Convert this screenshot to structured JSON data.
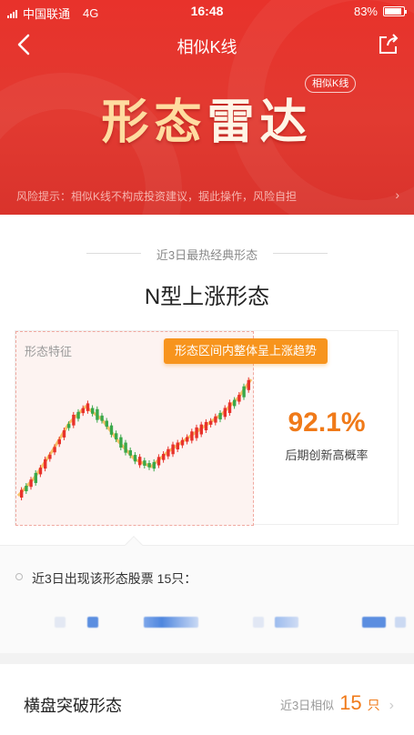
{
  "status_bar": {
    "carrier": "中国联通",
    "network": "4G",
    "time": "16:48",
    "battery": "83%"
  },
  "nav": {
    "title": "相似K线"
  },
  "hero": {
    "title_part1": "形",
    "title_part2": "态",
    "title_part3": "雷达",
    "badge": "相似K线",
    "risk_notice": "风险提示：相似K线不构成投资建议，据此操作，风险自担"
  },
  "featured": {
    "kicker": "近3日最热经典形态",
    "pattern_name": "N型上涨形态",
    "chart_label": "形态特征",
    "tooltip": "形态区间内整体呈上涨趋势",
    "probability": "92.1%",
    "probability_label": "后期创新高概率",
    "stocks_line": "近3日出现该形态股票 15只："
  },
  "list": [
    {
      "name": "横盘突破形态",
      "label": "近3日相似",
      "count": "15",
      "unit": "只"
    }
  ],
  "colors": {
    "header_red": "#e2342c",
    "accent_orange": "#f07a19",
    "candle_up": "#e8322b",
    "candle_down": "#3aa84a"
  },
  "icons": {
    "back": "chevron-left-icon",
    "share": "share-icon",
    "risk_more": "chevron-right-icon",
    "row_more": "chevron-right-icon"
  }
}
